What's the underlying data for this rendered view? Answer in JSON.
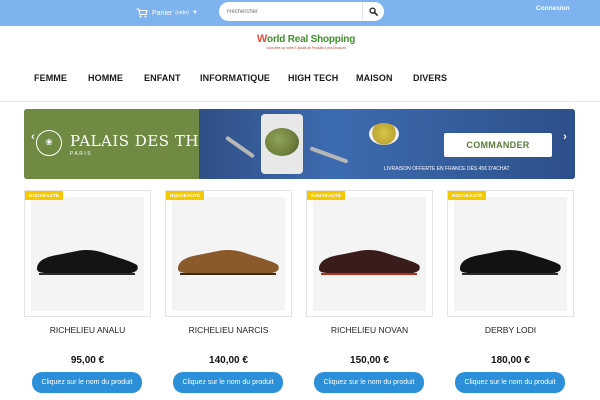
{
  "topbar": {
    "cart_label": "Panier",
    "cart_state": "(vide)",
    "search_placeholder": "Rechercher",
    "login_label": "Connexion"
  },
  "logo": {
    "title": "World Real Shopping",
    "tagline": "Vous êtes sur votre E-Boutik de Produits à prix Discount"
  },
  "nav": {
    "items": [
      "FEMME",
      "HOMME",
      "ENFANT",
      "INFORMATIQUE",
      "HIGH TECH",
      "MAISON",
      "DIVERS"
    ]
  },
  "banner": {
    "brand": "PALAIS DES THÉS",
    "city": "PARIS",
    "cta_label": "COMMANDER",
    "promo": "LIVRAISON OFFERTE EN FRANCE DÈS 45€ D'ACHAT"
  },
  "products": [
    {
      "badge": "NOUVEAUTÉ",
      "name": "RICHELIEU ANALU",
      "price": "95,00 €",
      "button": "Cliquez sur le nom du produit",
      "shoe_color": "#141414"
    },
    {
      "badge": "NOUVEAUTÉ",
      "name": "RICHELIEU NARCIS",
      "price": "140,00 €",
      "button": "Cliquez sur le nom du produit",
      "shoe_color": "#8a5a2b"
    },
    {
      "badge": "NOUVEAUTÉ",
      "name": "RICHELIEU NOVAN",
      "price": "150,00 €",
      "button": "Cliquez sur le nom du produit",
      "shoe_color": "#3a1c1a"
    },
    {
      "badge": "NOUVEAUTÉ",
      "name": "DERBY LODI",
      "price": "180,00 €",
      "button": "Cliquez sur le nom du produit",
      "shoe_color": "#121212"
    }
  ],
  "colors": {
    "topbar": "#7fb3f0",
    "accent_button": "#2b8fd9",
    "badge": "#f6c800",
    "banner_green": "#6e8a43"
  }
}
